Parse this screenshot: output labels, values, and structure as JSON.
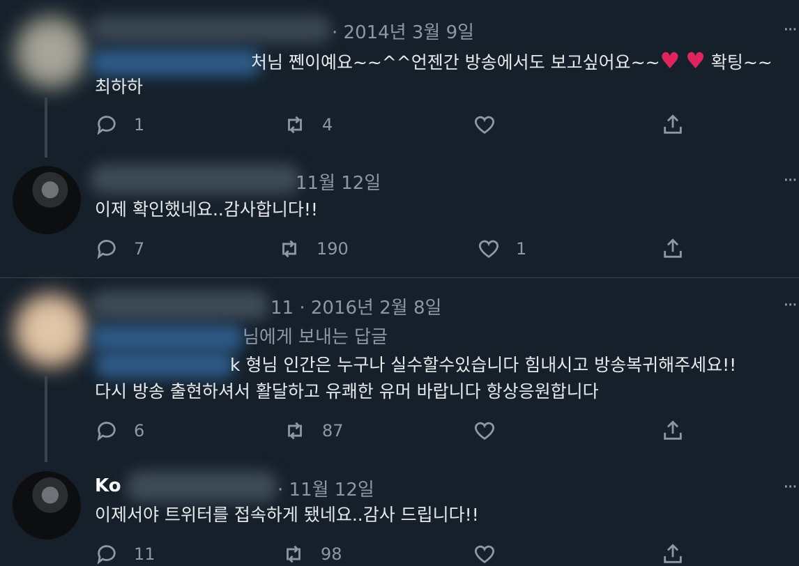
{
  "tweets": [
    {
      "date": "· 2014년 3월 9일",
      "text_lines": [
        "처님 쩬이예요~~^^언젠간 방송에서도 보고싶어요~~",
        "최하하"
      ],
      "hearts_suffix": "확팅~~",
      "heart_glyph": "♥",
      "reply_count": "1",
      "retweet_count": "4",
      "like_count": ""
    },
    {
      "date": "11월 12일",
      "text_lines": [
        "이제 확인했네요..감사합니다!!"
      ],
      "reply_count": "7",
      "retweet_count": "190",
      "like_count": "1"
    },
    {
      "date": "11 · 2016년 2월 8일",
      "reply_to": "님에게 보내는 답글",
      "text_lines": [
        "k 형님 인간은 누구나 실수할수있습니다  힘내시고 방송복귀해주세요!!",
        "다시 방송 출현하셔서 활달하고 유쾌한 유머 바랍니다 항상응원합니다"
      ],
      "reply_count": "6",
      "retweet_count": "87",
      "like_count": ""
    },
    {
      "name": "Ko",
      "date": "· 11월 12일",
      "text_lines": [
        "이제서야 트위터를 접속하게 됐네요..감사 드립니다!!"
      ],
      "reply_count": "11",
      "retweet_count": "98",
      "like_count": ""
    }
  ],
  "more_glyph": "···",
  "colors": {
    "background": "#15202b",
    "divider": "#38444d",
    "muted": "#8b98a5",
    "heart": "#e0245e"
  },
  "icons": [
    "reply-icon",
    "retweet-icon",
    "like-icon",
    "share-icon",
    "more-icon"
  ]
}
